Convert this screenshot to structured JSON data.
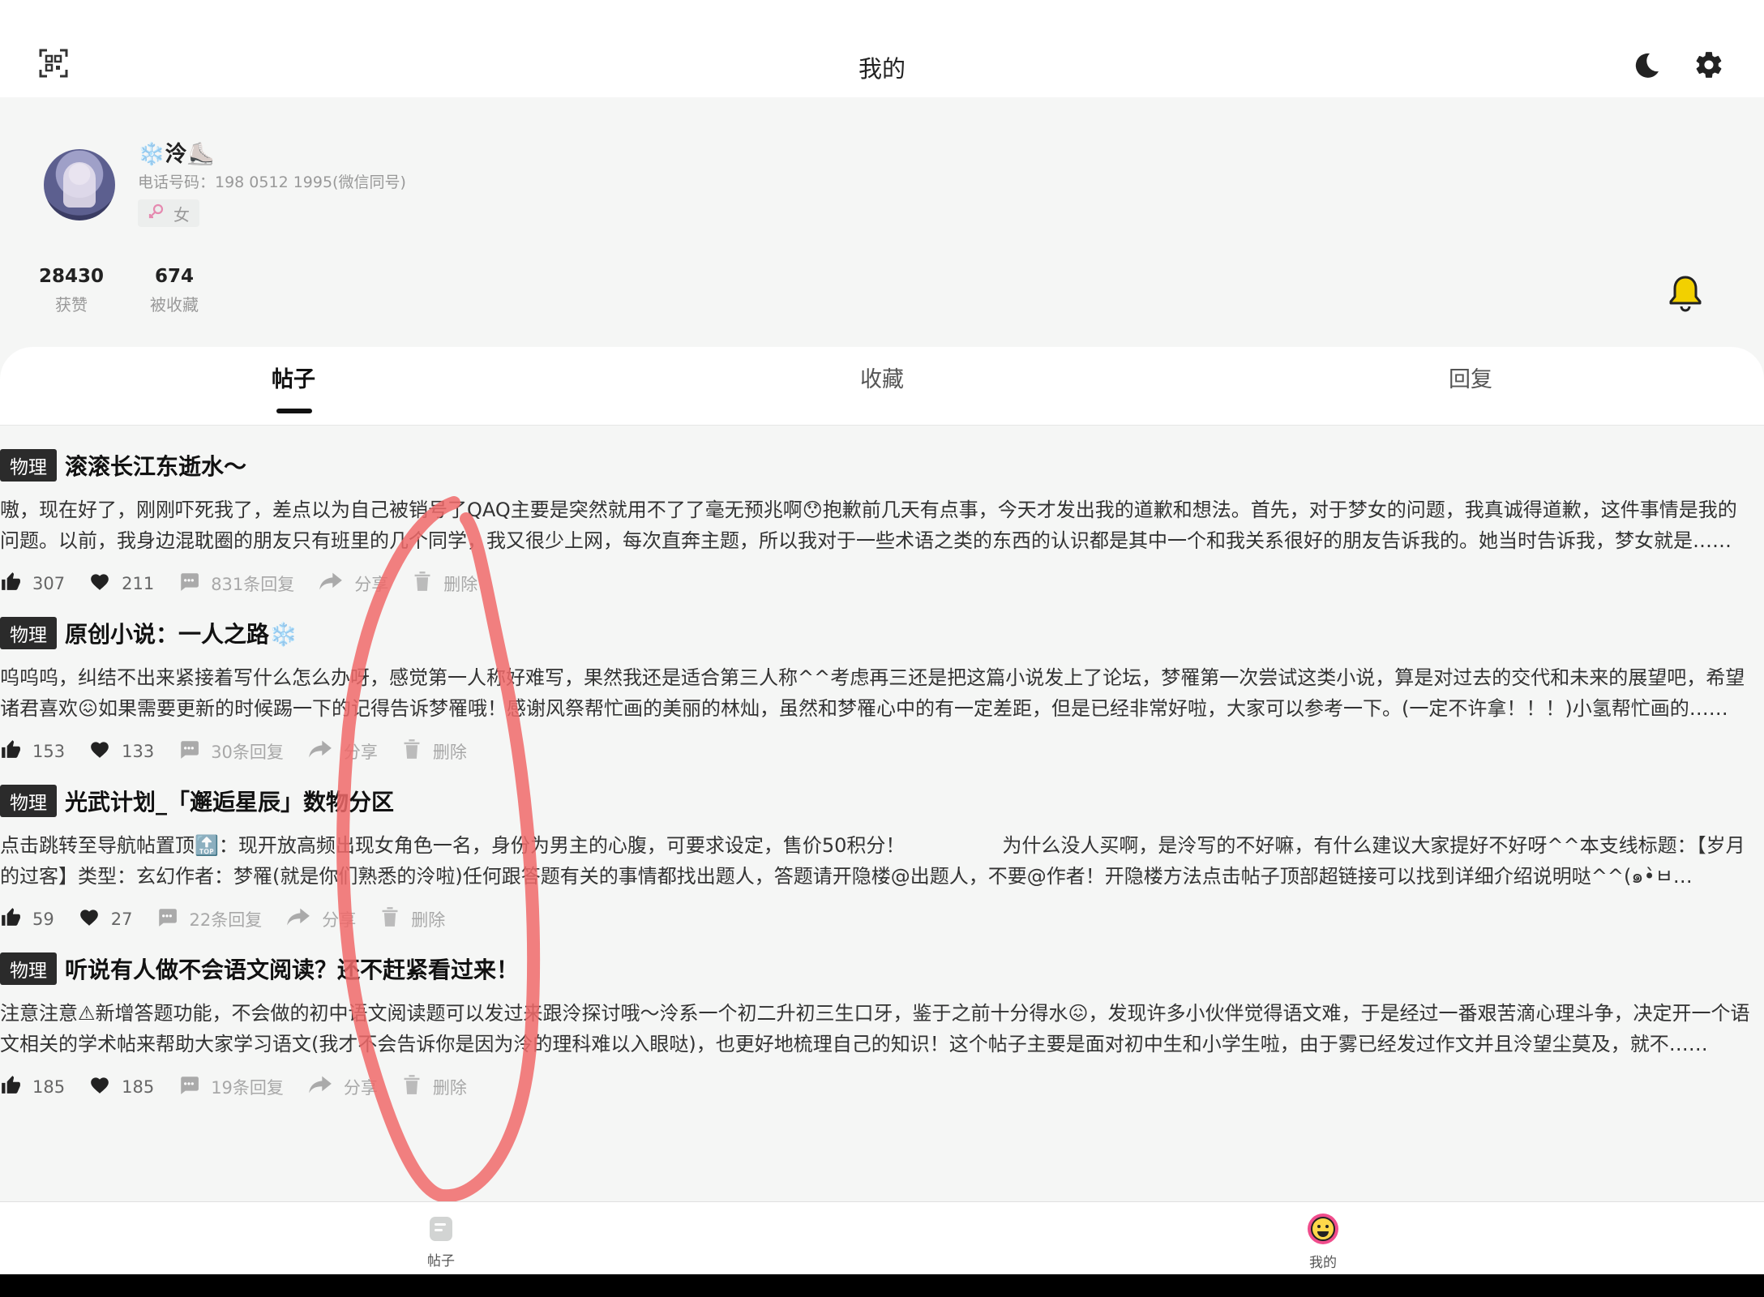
{
  "topbar": {
    "title": "我的",
    "scan_icon": "qr-scan-icon",
    "dark_mode_icon": "moon-icon",
    "settings_icon": "gear-icon"
  },
  "profile": {
    "nickname": "❄️泠⛸️",
    "phone": "电话号码：198 0512 1995(微信同号)",
    "gender": "女",
    "likes_count": "28430",
    "likes_label": "获赞",
    "favorited_count": "674",
    "favorited_label": "被收藏",
    "bell_color": "#f2d000"
  },
  "tabs": [
    "帖子",
    "收藏",
    "回复"
  ],
  "posts": [
    {
      "tag": "物理",
      "title": "滚滚长江东逝水～",
      "excerpt": "嗷，现在好了，刚刚吓死我了，差点以为自己被销号了QAQ主要是突然就用不了了毫无预兆啊😯抱歉前几天有点事，今天才发出我的道歉和想法。首先，对于梦女的问题，我真诚得道歉，这件事情是我的问题。以前，我身边混耽圈的朋友只有班里的几个同学，我又很少上网，每次直奔主题，所以我对于一些术语之类的东西的认识都是其中一个和我关系很好的朋友告诉我的。她当时告诉我，梦女就是……",
      "likes": "307",
      "favs": "211",
      "replies": "831条回复",
      "share": "分享",
      "delete": "删除"
    },
    {
      "tag": "物理",
      "title": "原创小说：一人之路❄️",
      "excerpt": "呜呜呜，纠结不出来紧接着写什么怎么办呀，感觉第一人称好难写，果然我还是适合第三人称^^考虑再三还是把这篇小说发上了论坛，梦罹第一次尝试这类小说，算是对过去的交代和未来的展望吧，希望诸君喜欢😖如果需要更新的时候踢一下的记得告诉梦罹哦！感谢风祭帮忙画的美丽的林灿，虽然和梦罹心中的有一定差距，但是已经非常好啦，大家可以参考一下。(一定不许拿！！！)小氢帮忙画的……",
      "likes": "153",
      "favs": "133",
      "replies": "30条回复",
      "share": "分享",
      "delete": "删除"
    },
    {
      "tag": "物理",
      "title": "光武计划_「邂逅星辰」数物分区",
      "excerpt": "点击跳转至导航帖置顶🔝：现开放高频出现女角色一名，身份为男主的心腹，可要求设定，售价50积分！　　　　　为什么没人买啊，是泠写的不好嘛，有什么建议大家提好不好呀^^本支线标题：【岁月的过客】类型：玄幻作者：梦罹(就是你们熟悉的泠啦)任何跟答题有关的事情都找出题人，答题请开隐楼@出题人，不要@作者！开隐楼方法点击帖子顶部超链接可以找到详细介绍说明哒^^(๑•̀ㅂ•́)و✧(๑...",
      "likes": "59",
      "favs": "27",
      "replies": "22条回复",
      "share": "分享",
      "delete": "删除"
    },
    {
      "tag": "物理",
      "title": "听说有人做不会语文阅读？还不赶紧看过来！",
      "excerpt": "注意注意⚠新增答题功能，不会做的初中语文阅读题可以发过来跟泠探讨哦～泠系一个初二升初三生口牙，鉴于之前十分得水😖，发现许多小伙伴觉得语文难，于是经过一番艰苦滴心理斗争，决定开一个语文相关的学术帖来帮助大家学习语文(我才不会告诉你是因为泠的理科难以入眼哒)，也更好地梳理自己的知识！这个帖子主要是面对初中生和小学生啦，由于雾已经发过作文并且泠望尘莫及，就不……",
      "likes": "185",
      "favs": "185",
      "replies": "19条回复",
      "share": "分享",
      "delete": "删除"
    }
  ],
  "bottom_nav": [
    {
      "label": "帖子",
      "icon": "posts-icon"
    },
    {
      "label": "我的",
      "icon": "smiley-profile-icon"
    }
  ],
  "annotation_color": "#f06a6a"
}
